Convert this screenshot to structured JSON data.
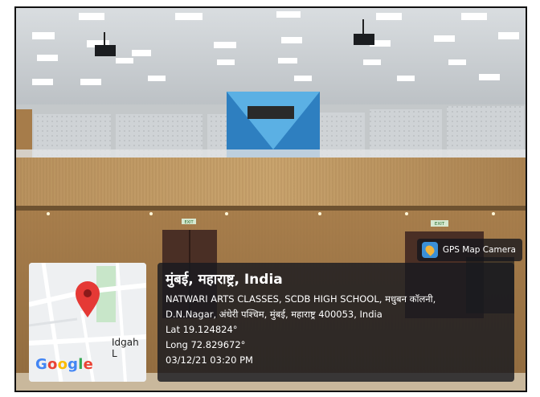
{
  "badge": {
    "app_name": "GPS Map Camera",
    "icon": "gps-map-camera-icon"
  },
  "map": {
    "road_label": "Idgah L",
    "brand": "Google",
    "pin_icon": "map-pin-icon"
  },
  "location": {
    "title": "मुंबई, महाराष्ट्र, India",
    "address_line1": "NATWARI ARTS CLASSES, SCDB HIGH SCHOOL, मधुबन कॉलनी,",
    "address_line2": "D.N.Nagar, अंधेरी पश्चिम, मुंबई, महाराष्ट्र 400053, India",
    "lat": "Lat 19.124824°",
    "long": "Long 72.829672°",
    "datetime": "03/12/21 03:20 PM"
  },
  "scene": {
    "exit_signs": [
      "EXIT",
      "EXIT"
    ]
  }
}
